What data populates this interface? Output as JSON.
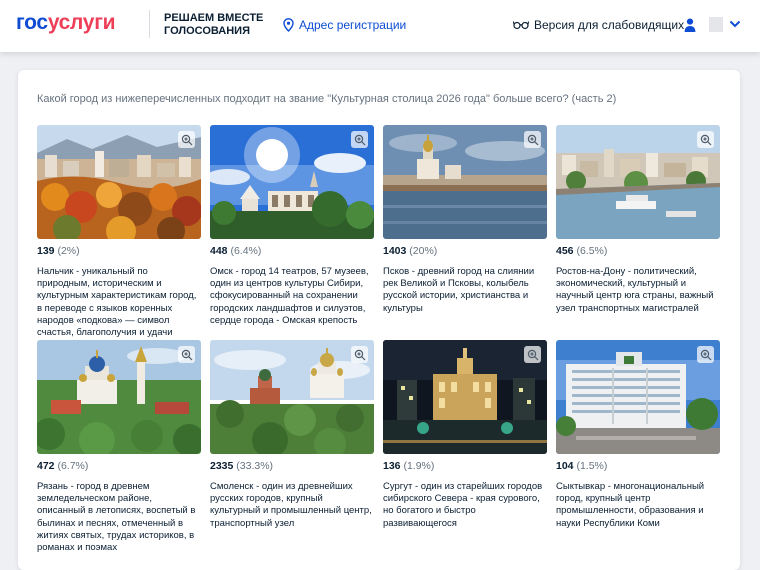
{
  "header": {
    "logo_part1": "гос",
    "logo_part2": "услуги",
    "slogan_line1": "Решаем вместе",
    "slogan_line2": "голосования",
    "region_link": "Адрес регистрации",
    "low_vision": "Версия для слабовидящих"
  },
  "question": "Какой город из нижеперечисленных подходит на звание \"Культурная столица 2026 года\" больше всего? (часть 2)",
  "options": [
    {
      "votes": "139",
      "percent": "(2%)",
      "description": "Нальчик - уникальный по природным, историческим и культурным характеристикам город, в переводе с языков коренных народов «подкова» — символ счастья, благополучия и удачи"
    },
    {
      "votes": "448",
      "percent": "(6.4%)",
      "description": "Омск - город 14 театров, 57 музеев, один из центров культуры Сибири, сфокусированный на сохранении городских ландшафтов и силуэтов, сердце города - Омская крепость"
    },
    {
      "votes": "1403",
      "percent": "(20%)",
      "description": "Псков - древний город на слиянии рек Великой и Псковы, колыбель русской истории, христианства и культуры"
    },
    {
      "votes": "456",
      "percent": "(6.5%)",
      "description": "Ростов-на-Дону - политический, экономический, культурный и научный центр юга страны, важный узел транспортных магистралей"
    },
    {
      "votes": "472",
      "percent": "(6.7%)",
      "description": "Рязань - город в древнем земледельческом районе, описанный в летописях, воспетый в былинах и песнях, отмеченный в житиях святых, трудах историков, в романах и поэмах"
    },
    {
      "votes": "2335",
      "percent": "(33.3%)",
      "description": "Смоленск - один из древнейших русских городов, крупный культурный и промышленный центр, транспортный узел"
    },
    {
      "votes": "136",
      "percent": "(1.9%)",
      "description": "Сургут - один из старейших городов сибирского Севера - края сурового, но богатого и быстро развивающегося"
    },
    {
      "votes": "104",
      "percent": "(1.5%)",
      "description": "Сыктывкар - многонациональный город, крупный центр промышленности, образования и науки Республики Коми"
    }
  ]
}
